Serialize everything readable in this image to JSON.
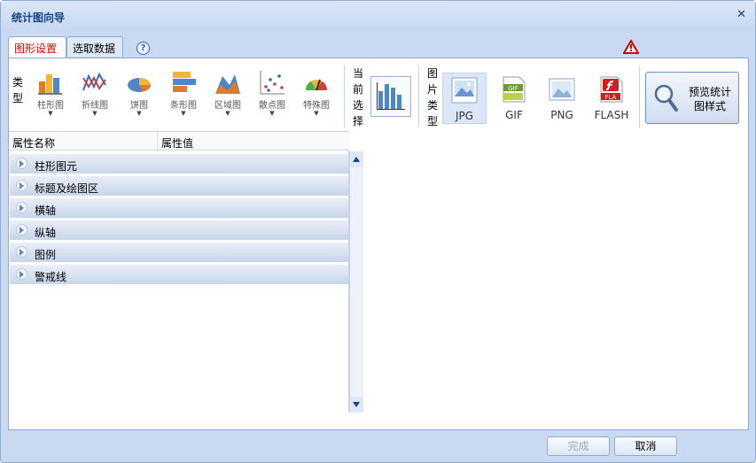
{
  "window": {
    "title": "统计图向导"
  },
  "tabs": [
    {
      "label": "图形设置"
    },
    {
      "label": "选取数据"
    }
  ],
  "help": {
    "symbol": "?"
  },
  "toolbar": {
    "type_label": [
      "类",
      "型"
    ],
    "chart_types": [
      {
        "label": "柱形图",
        "icon": "column-chart-icon"
      },
      {
        "label": "折线图",
        "icon": "line-chart-icon"
      },
      {
        "label": "饼图",
        "icon": "pie-chart-icon"
      },
      {
        "label": "条形图",
        "icon": "bar-chart-icon"
      },
      {
        "label": "区域图",
        "icon": "area-chart-icon"
      },
      {
        "label": "散点图",
        "icon": "scatter-chart-icon"
      },
      {
        "label": "特殊图",
        "icon": "gauge-chart-icon"
      }
    ],
    "current_label": [
      "当",
      "前",
      "选",
      "择"
    ],
    "image_type_label": [
      "图",
      "片",
      "类",
      "型"
    ],
    "image_types": [
      {
        "label": "JPG",
        "icon": "jpg-icon",
        "selected": true
      },
      {
        "label": "GIF",
        "icon": "gif-icon",
        "selected": false
      },
      {
        "label": "PNG",
        "icon": "png-icon",
        "selected": false
      },
      {
        "label": "FLASH",
        "icon": "flash-icon",
        "selected": false
      }
    ],
    "preview_button": [
      "预览统计",
      "图样式"
    ]
  },
  "property_grid": {
    "col_name": "属性名称",
    "col_value": "属性值",
    "groups": [
      "柱形图元",
      "标题及绘图区",
      "横轴",
      "纵轴",
      "图例",
      "警戒线"
    ]
  },
  "footer": {
    "finish": "完成",
    "cancel": "取消"
  },
  "colors": {
    "accent": "#15428b",
    "warning": "#cc0000"
  }
}
